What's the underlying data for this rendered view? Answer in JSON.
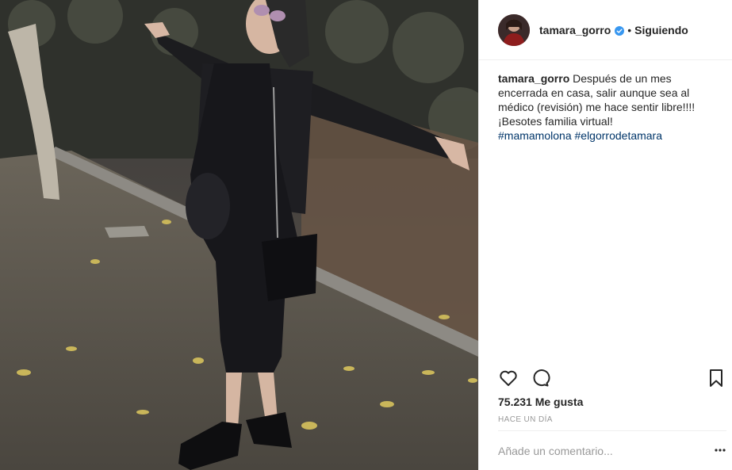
{
  "post": {
    "username": "tamara_gorro",
    "follow_status": "Siguiendo",
    "separator": "•",
    "caption": {
      "user": "tamara_gorro",
      "lines": [
        "Después de un mes",
        "encerrada en casa, salir aunque sea al",
        "médico (revisión) me hace sentir libre!!!!",
        "¡Besotes familia virtual!"
      ],
      "hashtags": [
        "#mamamolona",
        "#elgorrodetamara"
      ]
    },
    "likes": "75.231 Me gusta",
    "timestamp": "HACE UN DÍA",
    "comment_placeholder": "Añade un comentario...",
    "icons": {
      "like": "heart-icon",
      "comment": "comment-bubble-icon",
      "save": "bookmark-icon",
      "verified": "verified-badge-icon",
      "more": "more-options-icon"
    },
    "colors": {
      "verified": "#3897f0",
      "hashtag": "#003569",
      "muted": "#999999",
      "text": "#262626"
    }
  }
}
